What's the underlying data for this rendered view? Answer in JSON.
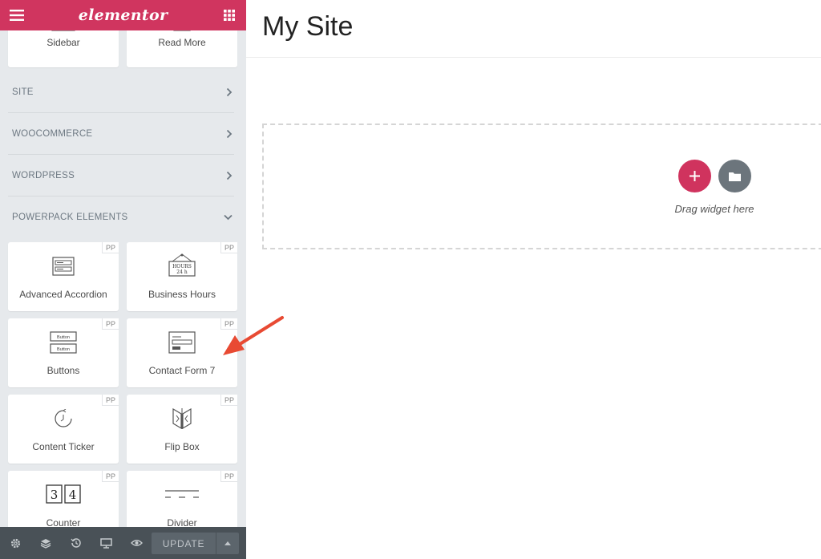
{
  "panel": {
    "logo": "elementor",
    "top_widgets": [
      {
        "title": "Sidebar"
      },
      {
        "title": "Read More"
      }
    ],
    "categories": [
      {
        "label": "SITE"
      },
      {
        "label": "WOOCOMMERCE"
      },
      {
        "label": "WORDPRESS"
      },
      {
        "label": "POWERPACK ELEMENTS"
      }
    ],
    "badge": "PP",
    "pp_widgets": [
      {
        "title": "Advanced Accordion",
        "icon": "accordion-icon"
      },
      {
        "title": "Business Hours",
        "icon": "business-hours-sign-icon",
        "sign_lines": [
          "HOURS",
          "24 h"
        ]
      },
      {
        "title": "Buttons",
        "icon": "buttons-icon",
        "button_labels": [
          "Button",
          "Button"
        ]
      },
      {
        "title": "Contact Form 7",
        "icon": "contact-form-icon"
      },
      {
        "title": "Content Ticker",
        "icon": "ticker-clock-icon"
      },
      {
        "title": "Flip Box",
        "icon": "flip-box-icon"
      },
      {
        "title": "Counter",
        "icon": "counter-digits-icon",
        "digits": [
          "3",
          "4"
        ]
      },
      {
        "title": "Divider",
        "icon": "divider-icon"
      }
    ]
  },
  "footer": {
    "update_label": "UPDATE",
    "icons": [
      "settings-icon",
      "layers-icon",
      "history-icon",
      "responsive-icon",
      "preview-icon"
    ]
  },
  "preview": {
    "site_title": "My Site",
    "drop_hint": "Drag widget here"
  },
  "colors": {
    "brand": "#d0355f",
    "panel_bg": "#e6e9ec",
    "footer_bg": "#495157",
    "annotation": "#e84a33"
  }
}
